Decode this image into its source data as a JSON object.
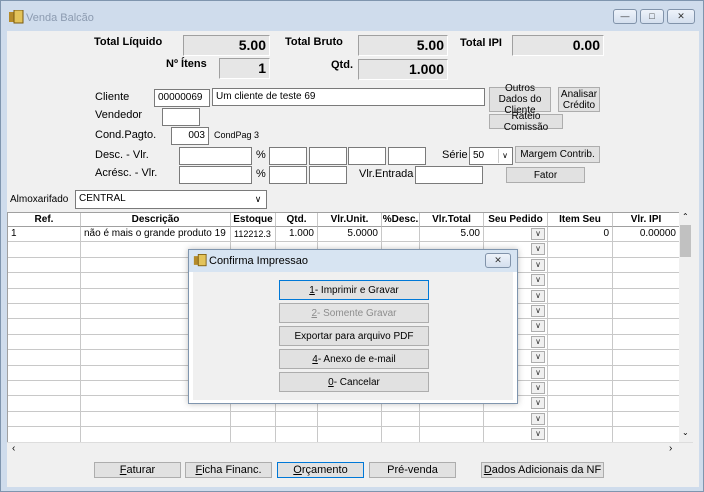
{
  "window": {
    "title": "Venda Balcão"
  },
  "totals": {
    "total_liquido_label": "Total Líquido",
    "total_liquido": "5.00",
    "total_bruto_label": "Total Bruto",
    "total_bruto": "5.00",
    "total_ipi_label": "Total IPI",
    "total_ipi": "0.00",
    "n_itens_label": "Nº Ítens",
    "n_itens": "1",
    "qtd_label": "Qtd.",
    "qtd": "1.000"
  },
  "form": {
    "cliente_label": "Cliente",
    "cliente_code": "00000069",
    "cliente_name": "Um cliente de teste 69",
    "vendedor_label": "Vendedor",
    "cond_label": "Cond.Pagto.",
    "cond_code": "003",
    "cond_name": "CondPag 3",
    "desc_label": "Desc. - Vlr.",
    "acresc_label": "Acrésc. - Vlr.",
    "pct": "%",
    "vlr_entrada_label": "Vlr.Entrada",
    "serie_label": "Série",
    "serie_value": "50",
    "almox_label": "Almoxarifado",
    "almox_value": "CENTRAL"
  },
  "buttons": {
    "outros_dados": "Outros Dados do Cliente",
    "analisar_credito": "Analisar Crédito",
    "rateio": "Rateio Comissão",
    "margem": "Margem Contrib.",
    "fator": "Fator"
  },
  "grid": {
    "headers": [
      "Ref.",
      "Descrição",
      "Estoque",
      "Qtd.",
      "Vlr.Unit.",
      "%Desc.",
      "Vlr.Total",
      "Seu Pedido",
      "Item Seu Pedi",
      "Vlr. IPI"
    ],
    "row": [
      "1",
      "não é mais o grande produto 19",
      "112212.3",
      "1.000",
      "5.0000",
      "",
      "5.00",
      "",
      "0",
      "0.00000"
    ]
  },
  "dialog": {
    "title": "Confirma Impressao",
    "b1_key": "1",
    "b1": "- Imprimir e Gravar",
    "b2_key": "2",
    "b2": " - Somente Gravar",
    "b3": "Exportar para arquivo PDF",
    "b4_key": "4",
    "b4": " - Anexo de e-mail",
    "b5_key": "0",
    "b5": " - Cancelar"
  },
  "bottom": {
    "faturar_key": "F",
    "faturar": "aturar",
    "ficha_key": "F",
    "ficha": "icha Financ.",
    "orc_key": "O",
    "orc": "rçamento",
    "prevenda": "Pré-venda",
    "dados_key": "D",
    "dados": "ados Adicionais da NF"
  }
}
